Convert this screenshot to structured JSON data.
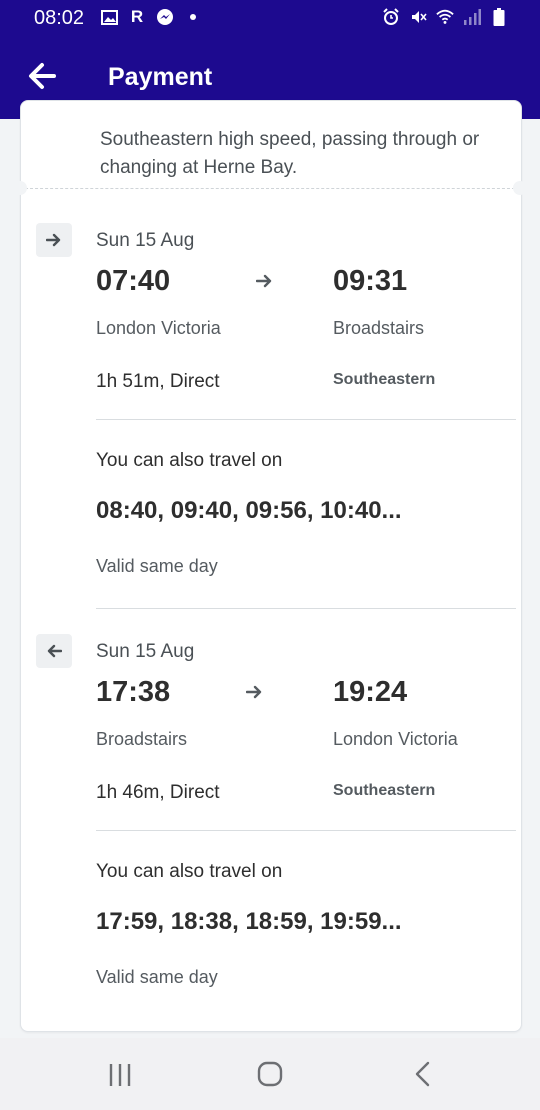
{
  "status_bar": {
    "time": "08:02",
    "left_icons": [
      "gallery-icon",
      "r-app-icon",
      "messenger-icon",
      "dot-icon"
    ],
    "right_icons": [
      "alarm-icon",
      "mute-icon",
      "wifi-icon",
      "signal-icon",
      "battery-icon"
    ]
  },
  "header": {
    "title": "Payment"
  },
  "intro_text": "Southeastern high speed, passing through or changing at Herne Bay.",
  "journeys": [
    {
      "direction": "outbound",
      "date": "Sun 15 Aug",
      "depart_time": "07:40",
      "arrive_time": "09:31",
      "from": "London Victoria",
      "to": "Broadstairs",
      "duration": "1h 51m, Direct",
      "operator": "Southeastern",
      "also_label": "You can also travel on",
      "also_times": "08:40, 09:40, 09:56, 10:40...",
      "validity": "Valid same day"
    },
    {
      "direction": "return",
      "date": "Sun 15 Aug",
      "depart_time": "17:38",
      "arrive_time": "19:24",
      "from": "Broadstairs",
      "to": "London Victoria",
      "duration": "1h 46m, Direct",
      "operator": "Southeastern",
      "also_label": "You can also travel on",
      "also_times": "17:59, 18:38, 18:59, 19:59...",
      "validity": "Valid same day"
    }
  ],
  "colors": {
    "header": "#1d0a8f",
    "card": "#ffffff",
    "background": "#f2f4f6"
  }
}
